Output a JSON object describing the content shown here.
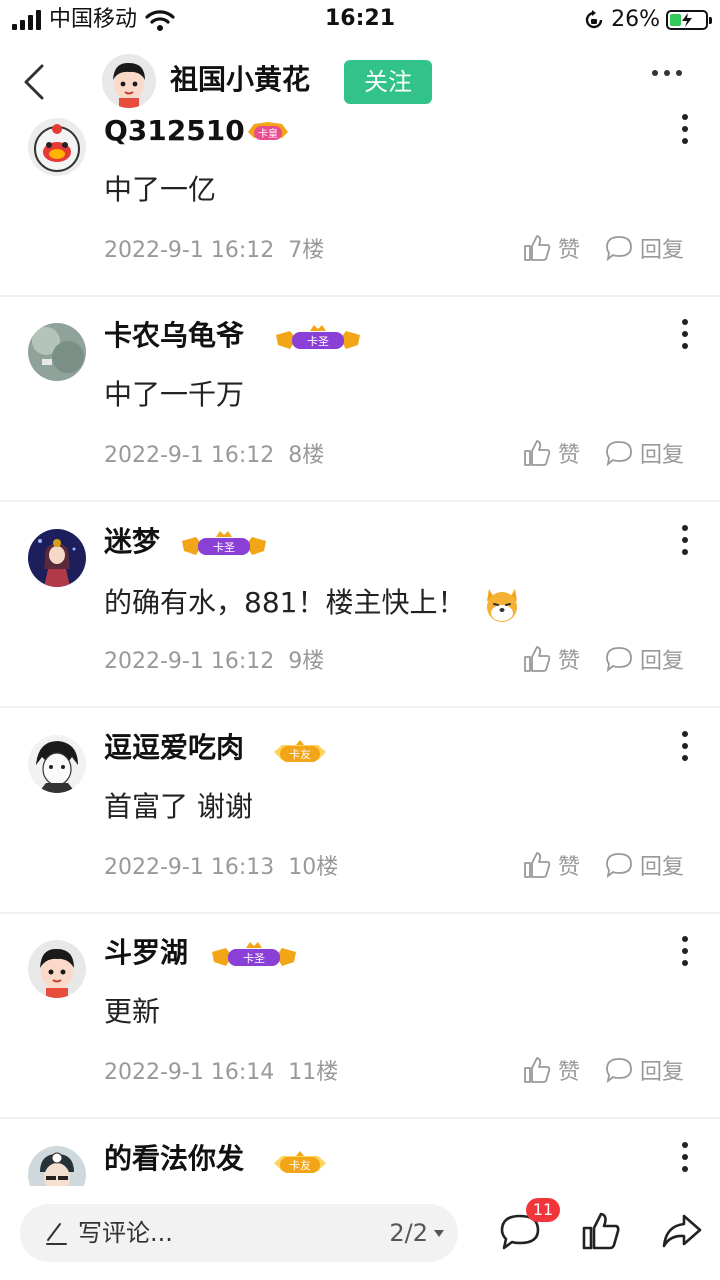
{
  "status_bar": {
    "carrier": "中国移动",
    "time": "16:21",
    "battery_percent": "26%",
    "battery_level": 0.26
  },
  "header": {
    "title": "祖国小黄花",
    "follow_label": "关注"
  },
  "badges": {
    "huang": "卡皇",
    "sheng": "卡圣",
    "you": "卡友"
  },
  "comments": [
    {
      "user": "Q312510",
      "badge": "卡皇",
      "text": "中了一亿",
      "date": "2022-9-1 16:12",
      "floor": "7楼",
      "like_label": "赞",
      "reply_label": "回复"
    },
    {
      "user": "卡农乌龟爷",
      "badge": "卡圣",
      "text": "中了一千万",
      "date": "2022-9-1 16:12",
      "floor": "8楼",
      "like_label": "赞",
      "reply_label": "回复"
    },
    {
      "user": "迷梦",
      "badge": "卡圣",
      "text": "的确有水，881！楼主快上！",
      "date": "2022-9-1 16:12",
      "floor": "9楼",
      "like_label": "赞",
      "reply_label": "回复"
    },
    {
      "user": "逗逗爱吃肉",
      "badge": "卡友",
      "text": "首富了 谢谢",
      "date": "2022-9-1 16:13",
      "floor": "10楼",
      "like_label": "赞",
      "reply_label": "回复"
    },
    {
      "user": "斗罗湖",
      "badge": "卡圣",
      "text": "更新",
      "date": "2022-9-1 16:14",
      "floor": "11楼",
      "like_label": "赞",
      "reply_label": "回复"
    },
    {
      "user": "的看法你发",
      "badge": "卡友"
    }
  ],
  "bottom_bar": {
    "placeholder": "写评论...",
    "page_indicator": "2/2",
    "comment_count": "11"
  },
  "colors": {
    "follow_green": "#31c38a",
    "badge_purple": "#8a3fd6",
    "badge_gold": "#f2a516",
    "count_red": "#f2353a"
  },
  "icons": [
    "back-arrow-icon",
    "more-dots-icon",
    "thumbs-up-icon",
    "speech-bubble-icon",
    "pen-icon",
    "share-arrow-icon",
    "shiba-emoji-icon"
  ]
}
